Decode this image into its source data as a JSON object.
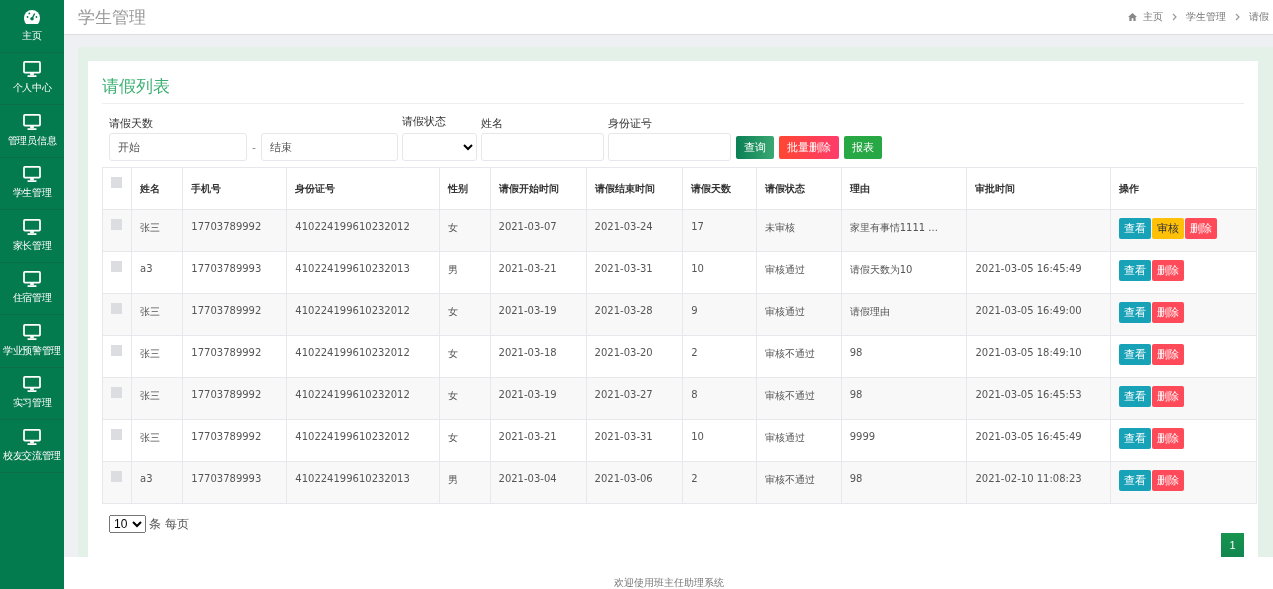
{
  "sidebar": {
    "items": [
      {
        "label": "主页",
        "selected": false
      },
      {
        "label": "个人中心",
        "selected": false
      },
      {
        "label": "管理员信息",
        "selected": false
      },
      {
        "label": "学生管理",
        "selected": false
      },
      {
        "label": "家长管理",
        "selected": false
      },
      {
        "label": "住宿管理",
        "selected": false
      },
      {
        "label": "学业预警管理",
        "selected": false
      },
      {
        "label": "实习管理",
        "selected": false
      },
      {
        "label": "校友交流管理",
        "selected": false
      }
    ]
  },
  "header": {
    "title": "学生管理",
    "breadcrumb": [
      "主页",
      "学生管理",
      "请假"
    ]
  },
  "panel": {
    "title": "请假列表",
    "filters": {
      "days_label": "请假天数",
      "days_from": {
        "placeholder": "开始"
      },
      "separator": "-",
      "days_to": {
        "placeholder": "结束"
      },
      "status_label": "请假状态",
      "name_label": "姓名",
      "id_label": "身份证号"
    },
    "buttons": [
      {
        "label": "查询",
        "kind": "search"
      },
      {
        "label": "批量删除",
        "kind": "delete"
      },
      {
        "label": "报表",
        "kind": "report"
      }
    ],
    "table": {
      "columns": [
        "姓名",
        "手机号",
        "身份证号",
        "性别",
        "请假开始时间",
        "请假结束时间",
        "请假天数",
        "请假状态",
        "理由",
        "审批时间",
        "操作"
      ],
      "header_checked": false,
      "rows": [
        {
          "checked": false,
          "cells": [
            "张三",
            "17703789992",
            "410224199610232012",
            "女",
            "2021-03-07",
            "2021-03-24",
            "17",
            "未审核",
            "家里有事情1111 ...",
            ""
          ],
          "actions": [
            {
              "label": "查看",
              "kind": "view"
            },
            {
              "label": "审核",
              "kind": "review"
            },
            {
              "label": "删除",
              "kind": "delete"
            }
          ]
        },
        {
          "checked": false,
          "cells": [
            "a3",
            "17703789993",
            "410224199610232013",
            "男",
            "2021-03-21",
            "2021-03-31",
            "10",
            "审核通过",
            "请假天数为10",
            "2021-03-05 16:45:49"
          ],
          "actions": [
            {
              "label": "查看",
              "kind": "view"
            },
            {
              "label": "删除",
              "kind": "delete"
            }
          ]
        },
        {
          "checked": false,
          "cells": [
            "张三",
            "17703789992",
            "410224199610232012",
            "女",
            "2021-03-19",
            "2021-03-28",
            "9",
            "审核通过",
            "请假理由",
            "2021-03-05 16:49:00"
          ],
          "actions": [
            {
              "label": "查看",
              "kind": "view"
            },
            {
              "label": "删除",
              "kind": "delete"
            }
          ]
        },
        {
          "checked": false,
          "cells": [
            "张三",
            "17703789992",
            "410224199610232012",
            "女",
            "2021-03-18",
            "2021-03-20",
            "2",
            "审核不通过",
            "98",
            "2021-03-05 18:49:10"
          ],
          "actions": [
            {
              "label": "查看",
              "kind": "view"
            },
            {
              "label": "删除",
              "kind": "delete"
            }
          ]
        },
        {
          "checked": false,
          "cells": [
            "张三",
            "17703789992",
            "410224199610232012",
            "女",
            "2021-03-19",
            "2021-03-27",
            "8",
            "审核不通过",
            "98",
            "2021-03-05 16:45:53"
          ],
          "actions": [
            {
              "label": "查看",
              "kind": "view"
            },
            {
              "label": "删除",
              "kind": "delete"
            }
          ]
        },
        {
          "checked": false,
          "cells": [
            "张三",
            "17703789992",
            "410224199610232012",
            "女",
            "2021-03-21",
            "2021-03-31",
            "10",
            "审核通过",
            "9999",
            "2021-03-05 16:45:49"
          ],
          "actions": [
            {
              "label": "查看",
              "kind": "view"
            },
            {
              "label": "删除",
              "kind": "delete"
            }
          ]
        },
        {
          "checked": false,
          "cells": [
            "a3",
            "17703789993",
            "410224199610232013",
            "男",
            "2021-03-04",
            "2021-03-06",
            "2",
            "审核不通过",
            "98",
            "2021-02-10 11:08:23"
          ],
          "actions": [
            {
              "label": "查看",
              "kind": "view"
            },
            {
              "label": "删除",
              "kind": "delete"
            }
          ]
        }
      ]
    },
    "page_size": {
      "value": "10",
      "suffix": "条 每页"
    },
    "pagination": [
      {
        "label": "1",
        "selected": true
      }
    ]
  },
  "footer": {
    "text": "欢迎使用班主任助理系统"
  }
}
